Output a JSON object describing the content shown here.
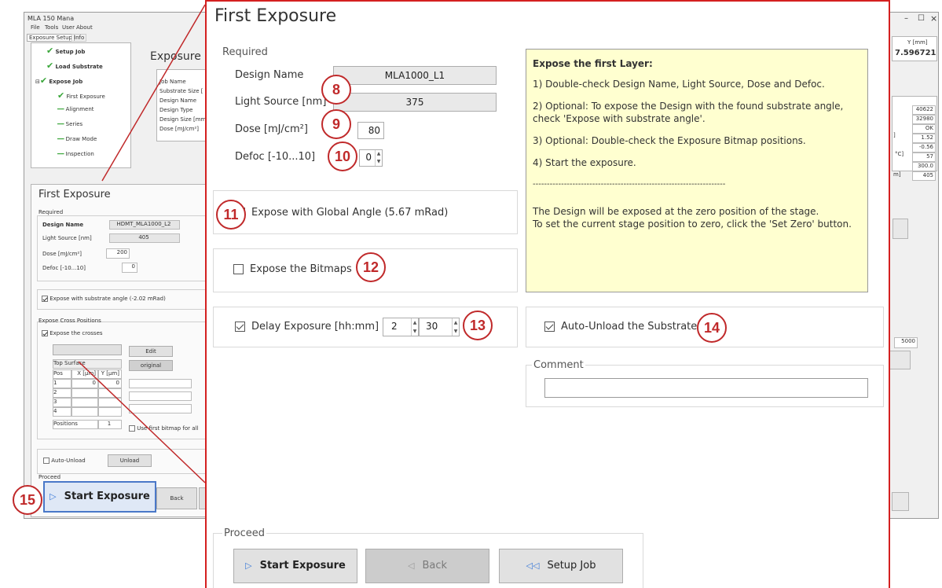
{
  "background_app": {
    "title": "MLA 150 Mana",
    "menu": [
      "File",
      "Tools",
      "User",
      "About"
    ],
    "tabs": [
      "Exposure Setup",
      "Info"
    ],
    "tree": {
      "setup_job": "Setup Job",
      "load_substrate": "Load Substrate",
      "expose_job": "Expose Job",
      "first_exposure": "First Exposure",
      "alignment": "Alignment",
      "series": "Series",
      "draw_mode": "Draw Mode",
      "inspection": "Inspection"
    },
    "exposure_info_title": "Exposure In",
    "info_rows": [
      "Job Name",
      "Substrate Size [",
      "Design Name",
      "Design Type",
      "Design Size [mm",
      "Dose [mJ/cm²]"
    ],
    "coord_header": "Y [mm]",
    "coord_value": "7.596721",
    "stats": [
      "40622",
      "32980",
      "OK",
      "1.52",
      "-0.56",
      "57",
      "300.0",
      "405"
    ],
    "stats_labels": [
      "]",
      "°C]",
      "m]"
    ],
    "right_field": "5000",
    "window_controls": {
      "minimize": "–",
      "maximize": "☐",
      "close": "×"
    },
    "first_exposure_panel": {
      "title": "First Exposure",
      "required": "Required",
      "design_name_label": "Design Name",
      "design_name_value": "HDMT_MLA1000_L2",
      "light_source_label": "Light Source [nm]",
      "light_source_value": "405",
      "dose_label": "Dose [mJ/cm²]",
      "dose_value": "200",
      "defoc_label": "Defoc [-10...10]",
      "defoc_value": "0",
      "substrate_angle": "Expose with substrate angle (-2.02 mRad)",
      "cross_positions_title": "Expose Cross Positions",
      "expose_crosses": "Expose the crosses",
      "edit": "Edit",
      "original": "original",
      "surface": "Top Surface",
      "table_headers": [
        "Pos",
        "X [µm]",
        "Y [µm]"
      ],
      "table_rows": [
        [
          "1",
          "0",
          "0"
        ],
        [
          "2",
          "",
          ""
        ],
        [
          "3",
          "",
          ""
        ],
        [
          "4",
          "",
          ""
        ]
      ],
      "positions_label": "Positions",
      "positions_value": "1",
      "use_first_bitmap": "Use first bitmap for all",
      "auto_unload": "Auto-Unload",
      "unload": "Unload",
      "proceed": "Proceed",
      "back": "Back"
    },
    "start_exposure": "Start Exposure"
  },
  "dialog": {
    "title": "First Exposure",
    "required": {
      "legend": "Required",
      "design_name_label": "Design Name",
      "design_name_value": "MLA1000_L1",
      "light_source_label": "Light Source [nm]",
      "light_source_value": "375",
      "dose_label": "Dose [mJ/cm²]",
      "dose_value": "80",
      "defoc_label": "Defoc [-10...10]",
      "defoc_value": "0"
    },
    "instructions": {
      "title": "Expose the first Layer:",
      "step1": "1) Double-check Design Name, Light Source, Dose and Defoc.",
      "step2": "2) Optional: To expose the Design with the found substrate angle, check 'Expose with substrate angle'.",
      "step3": "3) Optional: Double-check the Exposure Bitmap positions.",
      "step4": "4) Start the exposure.",
      "separator": "--------------------------------------------------------------------",
      "note1": "The Design will be exposed at the zero position of the stage.",
      "note2": "To set the current stage position to zero, click the 'Set Zero' button."
    },
    "global_angle": "Expose with Global Angle (5.67 mRad)",
    "expose_bitmaps": "Expose the Bitmaps",
    "delay_exposure_label": "Delay Exposure [hh:mm]",
    "delay_hours": "2",
    "delay_minutes": "30",
    "auto_unload": "Auto-Unload the Substrate",
    "comment_label": "Comment",
    "comment_value": "",
    "proceed_legend": "Proceed",
    "start_exposure": "Start Exposure",
    "back": "Back",
    "setup_job": "Setup Job"
  },
  "callouts": {
    "c8": "8",
    "c9": "9",
    "c10": "10",
    "c11": "11",
    "c12": "12",
    "c13": "13",
    "c14": "14",
    "c15": "15"
  },
  "colors": {
    "callout": "#c0292a",
    "dialog_border": "#d42020",
    "instructions_bg": "#ffffd0",
    "check_green": "#3aa63a"
  }
}
